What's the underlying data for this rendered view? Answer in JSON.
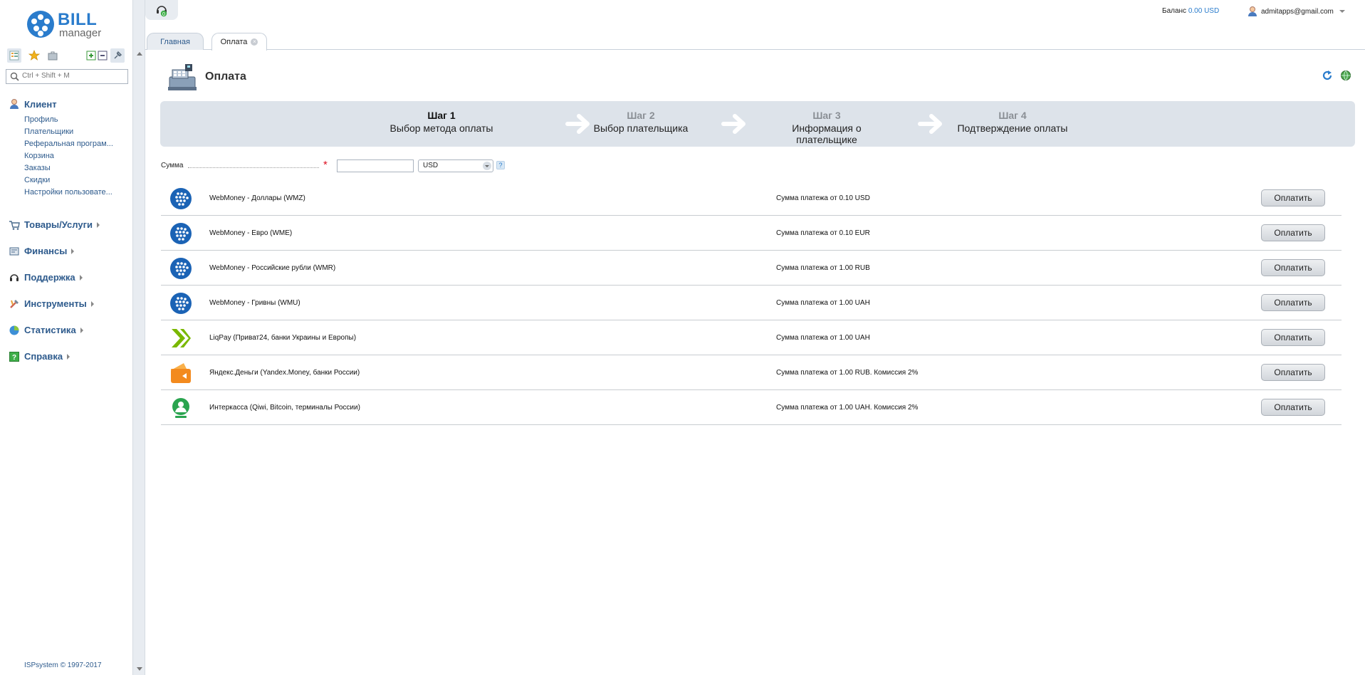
{
  "logo": {
    "brand": "BILL",
    "product": "manager"
  },
  "sidebar": {
    "search_placeholder": "Ctrl + Shift + M",
    "groups": [
      {
        "label": "Клиент",
        "icon": "client-icon",
        "expanded": true,
        "items": [
          "Профиль",
          "Плательщики",
          "Реферальная програм...",
          "Корзина",
          "Заказы",
          "Скидки",
          "Настройки пользовате..."
        ]
      },
      {
        "label": "Товары/Услуги",
        "icon": "cart-icon",
        "expanded": false
      },
      {
        "label": "Финансы",
        "icon": "finance-icon",
        "expanded": false
      },
      {
        "label": "Поддержка",
        "icon": "headset-icon",
        "expanded": false
      },
      {
        "label": "Инструменты",
        "icon": "tools-icon",
        "expanded": false
      },
      {
        "label": "Статистика",
        "icon": "stats-icon",
        "expanded": false
      },
      {
        "label": "Справка",
        "icon": "help-icon",
        "expanded": false
      }
    ],
    "copyright": "ISPsystem © 1997-2017"
  },
  "topbar": {
    "support_badge": "0",
    "balance_label": "Баланс",
    "balance_value": "0.00 USD",
    "user": "admitapps@gmail.com"
  },
  "tabs": [
    {
      "label": "Главная",
      "active": false
    },
    {
      "label": "Оплата",
      "active": true
    }
  ],
  "page": {
    "title": "Оплата",
    "steps": [
      {
        "num": "Шаг 1",
        "label": "Выбор метода оплаты",
        "active": true
      },
      {
        "num": "Шаг 2",
        "label": "Выбор плательщика",
        "active": false
      },
      {
        "num": "Шаг 3",
        "label": "Информация о плательщике",
        "active": false
      },
      {
        "num": "Шаг 4",
        "label": "Подтверждение оплаты",
        "active": false
      }
    ],
    "sum_label": "Сумма",
    "sum_value": "",
    "currency": "USD",
    "help": "?",
    "pay_label": "Оплатить",
    "methods": [
      {
        "name": "WebMoney - Доллары (WMZ)",
        "info": "Сумма платежа от 0.10 USD",
        "icon": "webmoney-icon",
        "color": "#1b63b5"
      },
      {
        "name": "WebMoney - Евро (WME)",
        "info": "Сумма платежа от 0.10 EUR",
        "icon": "webmoney-icon",
        "color": "#1b63b5"
      },
      {
        "name": "WebMoney - Российские рубли (WMR)",
        "info": "Сумма платежа от 1.00 RUB",
        "icon": "webmoney-icon",
        "color": "#1b63b5"
      },
      {
        "name": "WebMoney - Гривны (WMU)",
        "info": "Сумма платежа от 1.00 UAH",
        "icon": "webmoney-icon",
        "color": "#1b63b5"
      },
      {
        "name": "LiqPay (Приват24, банки Украины и Европы)",
        "info": "Сумма платежа от 1.00 UAH",
        "icon": "liqpay-icon",
        "color": "#7ab800"
      },
      {
        "name": "Яндекс.Деньги (Yandex.Money, банки России)",
        "info": "Сумма платежа от 1.00 RUB. Комиссия 2%",
        "icon": "yandex-money-icon",
        "color": "#f38a1e"
      },
      {
        "name": "Интеркасса (Qiwi, Bitcoin, терминалы России)",
        "info": "Сумма платежа от 1.00 UAH. Комиссия 2%",
        "icon": "interkassa-icon",
        "color": "#2aa44f"
      }
    ]
  }
}
